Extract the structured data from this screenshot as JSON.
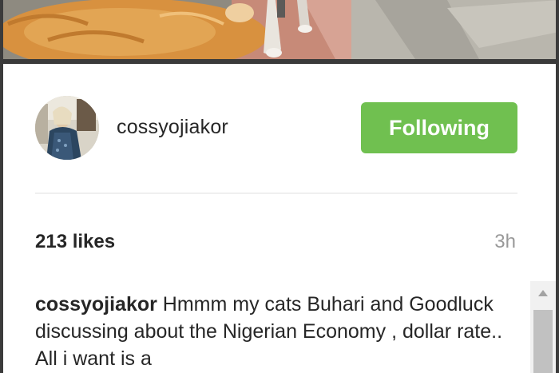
{
  "post": {
    "username": "cossyojiakor",
    "follow_button_label": "Following",
    "likes": "213 likes",
    "timestamp": "3h",
    "caption_user": "cossyojiakor",
    "caption_text": " Hmmm my cats Buhari and Goodluck discussing about the Nigerian Economy , dollar rate.. All i want is a"
  },
  "colors": {
    "follow_button_bg": "#70c050",
    "follow_button_text": "#ffffff",
    "timestamp": "#999999",
    "text": "#262626"
  },
  "icons": {
    "scroll_up": "triangle-up-icon"
  }
}
